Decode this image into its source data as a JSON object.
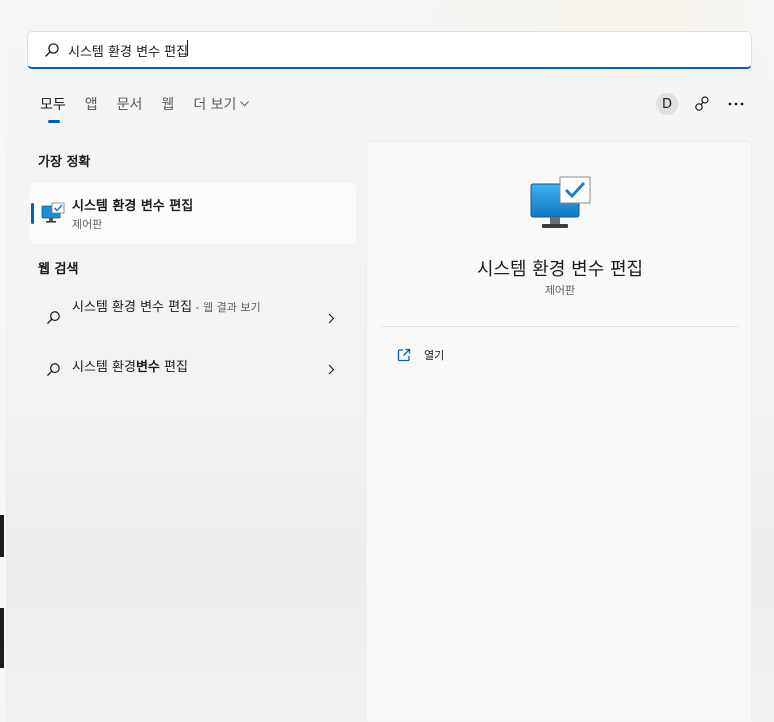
{
  "search": {
    "value": "시스템 환경 변수 편집"
  },
  "tabs": [
    {
      "label": "모두",
      "active": true
    },
    {
      "label": "앱"
    },
    {
      "label": "문서"
    },
    {
      "label": "웹"
    },
    {
      "label": "더 보기"
    }
  ],
  "account": {
    "initial": "D"
  },
  "best_match": {
    "section_title": "가장 정확",
    "title": "시스템 환경 변수 편집",
    "subtitle": "제어판"
  },
  "web": {
    "section_title": "웹 검색",
    "items": [
      {
        "text": "시스템 환경 변수 편집",
        "suffix": " - 웹 결과 보기"
      },
      {
        "text_plain_1": "시스템 환경",
        "text_bold": "변수",
        "text_plain_2": " 편집"
      }
    ]
  },
  "preview": {
    "title": "시스템 환경 변수 편집",
    "subtitle": "제어판",
    "actions": [
      {
        "label": "열기"
      }
    ]
  },
  "colors": {
    "accent": "#005fb8"
  }
}
